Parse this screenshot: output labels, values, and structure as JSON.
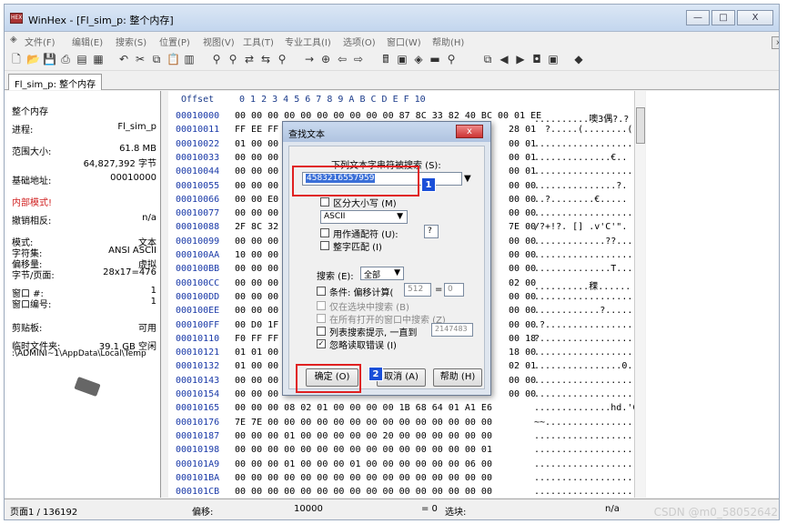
{
  "window": {
    "title": "WinHex - [Fl_sim_p: 整个内存]",
    "icon": "winhex-app-icon"
  },
  "window_buttons": [
    "—",
    "□",
    "X"
  ],
  "menu": [
    "文件(F)",
    "编辑(E)",
    "搜索(S)",
    "位置(P)",
    "视图(V)",
    "工具(T)",
    "专业工具(I)",
    "选项(O)",
    "窗口(W)",
    "帮助(H)"
  ],
  "mdi_buttons": [
    "_",
    "□",
    "x"
  ],
  "tab": {
    "label": "Fl_sim_p: 整个内存"
  },
  "left": {
    "heading": "整个内存",
    "process_label": "进程:",
    "process_value": "Fl_sim_p",
    "size_label": "范围大小:",
    "size_value1": "61.8 MB",
    "size_value2": "64,827,392 字节",
    "base_label": "基础地址:",
    "base_value": "00010000",
    "mode_label": "内部模式!",
    "undo_label": "撤销相反:",
    "undo_value": "n/a",
    "mode2_label": "模式:",
    "mode2_value": "文本",
    "charset_label": "字符集:",
    "charset_value": "ANSI ASCII",
    "offset_label": "偏移量:",
    "offset_value": "虚拟",
    "bytes_label": "字节/页面:",
    "bytes_value": "28x17=476",
    "window_no_label": "窗口 #:",
    "window_no_value": "1",
    "window_count_label": "窗口编号:",
    "window_count_value": "1",
    "clipboard_label": "剪贴板:",
    "clipboard_value": "可用",
    "temp_label": "临时文件夹:",
    "temp_value": "39.1 GB 空闲",
    "temp_path": ":\\ADMINI~1\\AppData\\Local\\Temp"
  },
  "hex": {
    "header_offset": "Offset",
    "header_cols": "0  1  2  3  4  5  6  7   8  9  A  B  C  D  E  F  10",
    "offsets": [
      "00010000",
      "00010011",
      "00010022",
      "00010033",
      "00010044",
      "00010055",
      "00010066",
      "00010077",
      "00010088",
      "00010099",
      "000100AA",
      "000100BB",
      "000100CC",
      "000100DD",
      "000100EE",
      "000100FF",
      "00010110",
      "00010121",
      "00010132",
      "00010143",
      "00010154",
      "00010165",
      "00010176",
      "00010187",
      "00010198",
      "000101A9",
      "000101BA",
      "000101CB"
    ],
    "rows": [
      "00 00 00 00 00 00 00 00 00 00 87 8C 33 82 40 BC 00 01 EE",
      "FF EE FF                                          28 01",
      "01 00 00                                          00 01",
      "00 00 00                                          00 01",
      "00 00 00                                          00 01",
      "00 00 00                                          00 00",
      "00 00 E0                                          00 00",
      "00 00 00                                          00 00",
      "2F 8C 32                                          7E 00",
      "00 00 00                                          00 00",
      "10 00 00                                          00 00",
      "00 00 00                                          00 00",
      "00 00 00                                          02 00",
      "00 00 00                                          00 00",
      "00 00 00                                          00 00",
      "00 D0 1F                                          00 00",
      "F0 FF FF                                          00 18",
      "01 01 00                                          18 00",
      "01 00 00                                          02 01",
      "00 00 00                                          00 00",
      "00 00 00                                          00 00",
      "00 00 00 08 02 01 00 00 00 00 1B 68 64 01 A1 E6",
      "7E 7E 00 00 00 00 00 00 00 00 00 00 00 00 00 00",
      "00 00 00 01 00 00 00 00 00 20 00 00 00 00 00 00",
      "00 00 00 00 00 00 00 00 00 00 00 00 00 00 00 01",
      "00 00 00 01 00 00 00 01 00 00 00 00 00 00 06 00",
      "00 00 00 00 00 00 00 00 00 00 00 00 00 00 00 00",
      "00 00 00 00 00 00 00 00 00 00 00 00 00 00 00 00"
    ],
    "text": [
      "..........噢3偶?.?",
      "  ?.....(........(",
      "..................",
      "..............€..",
      "..................",
      "...............?.",
      "..?........€.....",
      "..................",
      "/?+!?. [] .v'C'\".",
      ".............??...",
      "..................",
      "..............T...",
      "..........稞......",
      "..................",
      "............?.....",
      ".?................",
      "?.................",
      "..................",
      "................0.",
      "..................",
      "..................",
      "..............hd.'C",
      "~~................",
      "..................",
      "..................",
      "..................",
      "..................",
      ".................."
    ]
  },
  "dialog": {
    "title": "查找文本",
    "close": "x",
    "prompt": "下列文本字串符被搜索 (S):",
    "search_value": "4583216557959",
    "case_label": "区分大小写 (M)",
    "encoding": "ASCII",
    "wildcard_label": "用作通配符 (U):",
    "wildcard_value": "?",
    "whole_word_label": "整字匹配 (I)",
    "search_dir_label": "搜索 (E):",
    "search_dir_value": "全部",
    "cond_label": "条件: 偏移计算(",
    "cond_v1": "512",
    "cond_eq": "=",
    "cond_v2": "0",
    "sel_only_label": "仅在选块中搜索 (B)",
    "all_windows_label": "在所有打开的窗口中搜索 (Z)",
    "list_label": "列表搜索提示, 一直到",
    "list_value": "2147483",
    "ignore_label": "忽略读取错误 (I)",
    "ok": "确定 (O)",
    "cancel": "取消 (A)",
    "help": "帮助 (H)"
  },
  "annotations": {
    "badge1": "1",
    "badge2": "2"
  },
  "status": {
    "page": "页面1 / 136192",
    "offset_label": "偏移:",
    "offset_value": "10000",
    "eq": "= 0",
    "selection_label": "选块:",
    "na": "n/a"
  },
  "watermark": "CSDN @m0_58052642",
  "colors": {
    "accent": "#1a4fd8",
    "highlight": "#e02020",
    "offset_blue": "#1a3aa8",
    "mode_red": "#d02020"
  }
}
